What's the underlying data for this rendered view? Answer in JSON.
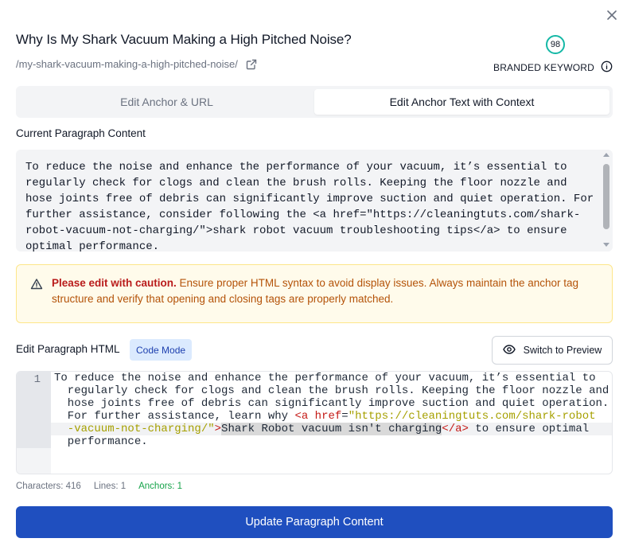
{
  "header": {
    "title": "Why Is My Shark Vacuum Making a High Pitched Noise?",
    "url": "/my-shark-vacuum-making-a-high-pitched-noise/",
    "score": "98",
    "branded_keyword_label": "BRANDED KEYWORD"
  },
  "tabs": [
    {
      "label": "Edit Anchor & URL",
      "active": false
    },
    {
      "label": "Edit Anchor Text with Context",
      "active": true
    }
  ],
  "current": {
    "label": "Current Paragraph Content",
    "text": "To reduce the noise and enhance the performance of your vacuum, it’s essential to regularly check for clogs and clean the brush rolls. Keeping the floor nozzle and hose joints free of debris can significantly improve suction and quiet operation. For further assistance, consider following the <a href=\"https://cleaningtuts.com/shark-robot-vacuum-not-charging/\">shark robot vacuum troubleshooting tips</a> to ensure optimal performance."
  },
  "warning": {
    "bold": "Please edit with caution.",
    "text": " Ensure proper HTML syntax to avoid display issues. Always maintain the anchor tag structure and verify that opening and closing tags are properly matched."
  },
  "editor": {
    "label": "Edit Paragraph HTML",
    "mode_badge": "Code Mode",
    "preview_button": "Switch to Preview",
    "line_number": "1",
    "rows": {
      "r1": "To reduce the noise and enhance the performance of your vacuum, it’s essential to",
      "r2": "  regularly check for clogs and clean the brush rolls. Keeping the floor nozzle and",
      "r3": "  hose joints free of debris can significantly improve suction and quiet operation.",
      "r4_text": "  For further assistance, learn why ",
      "r4_tag": "<a ",
      "r4_attr": "href",
      "r4_eq": "=",
      "r4_str": "\"https://cleaningtuts.com/shark-robot",
      "r5_str": "  -vacuum-not-charging/\"",
      "r5_close": ">",
      "r5_sel": "Shark Robot vacuum isn't charging",
      "r5_endtag": "</a>",
      "r5_rest": " to ensure optimal",
      "r6": "  performance."
    }
  },
  "stats": {
    "characters": "Characters: 416",
    "lines": "Lines: 1",
    "anchors": "Anchors: 1"
  },
  "update_button": "Update Paragraph Content",
  "colors": {
    "primary": "#1f4fbf",
    "warning_bg": "#fffbeb",
    "warning_text": "#b45309",
    "anchors_green": "#16a34a",
    "score_ring": "#14b8a6"
  }
}
